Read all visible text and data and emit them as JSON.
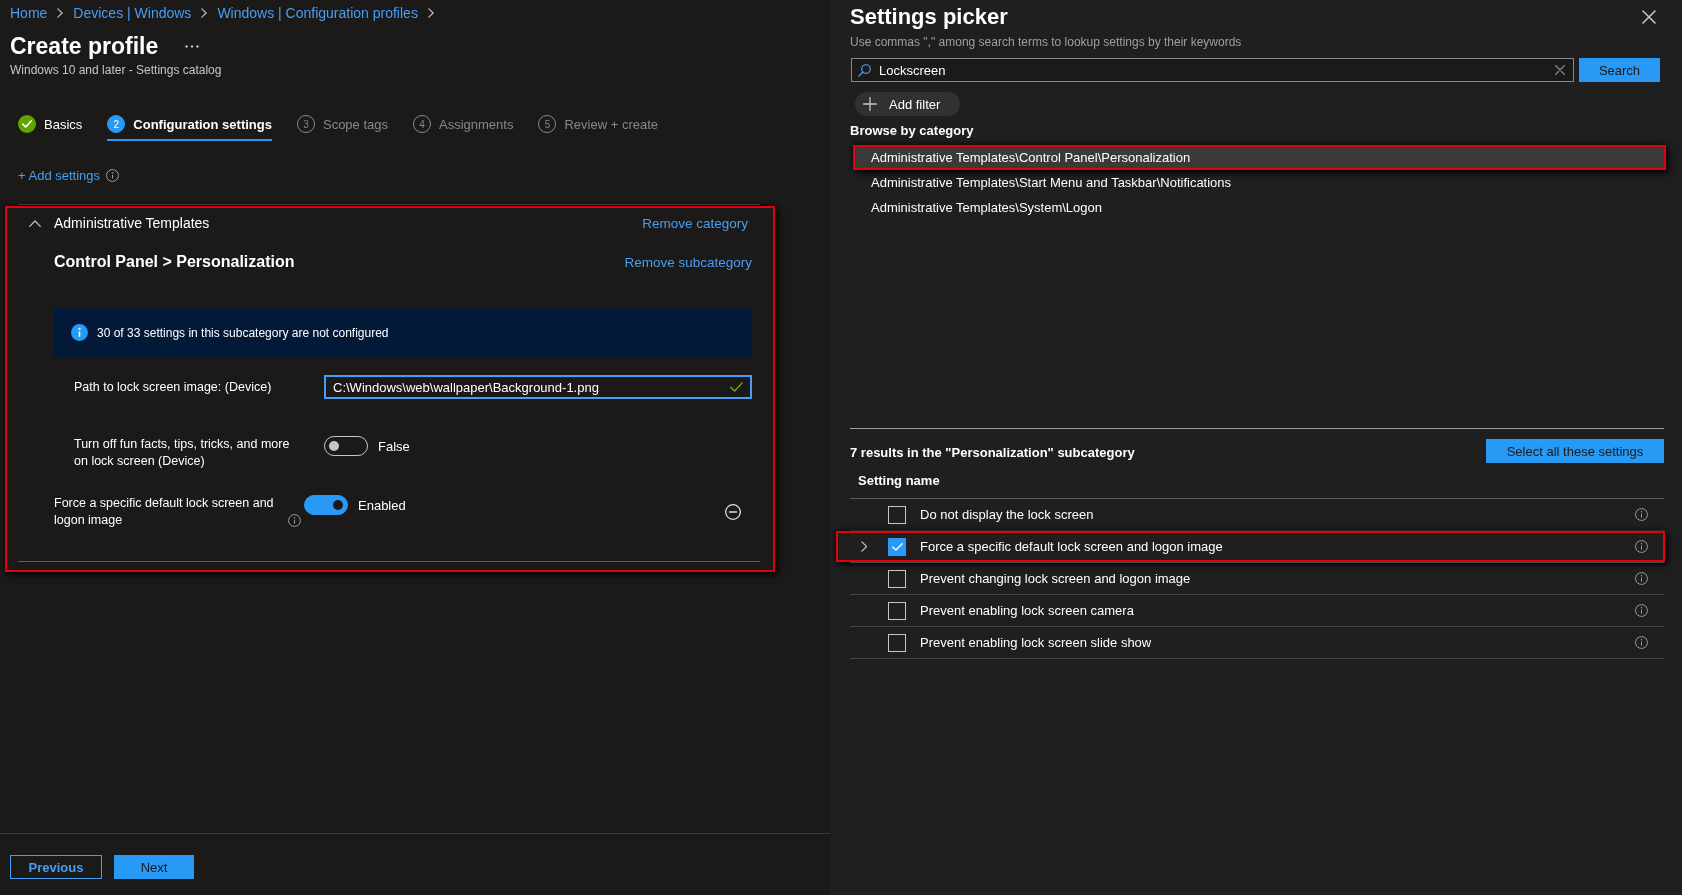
{
  "breadcrumb": [
    "Home",
    "Devices | Windows",
    "Windows | Configuration profiles"
  ],
  "header": {
    "title": "Create profile",
    "subtitle": "Windows 10 and later - Settings catalog"
  },
  "wizard_steps": [
    {
      "label": "Basics",
      "completed": true,
      "selected": false
    },
    {
      "number": "2",
      "label": "Configuration settings",
      "completed": false,
      "selected": true
    },
    {
      "number": "3",
      "label": "Scope tags",
      "completed": false,
      "selected": false
    },
    {
      "number": "4",
      "label": "Assignments",
      "completed": false,
      "selected": false
    },
    {
      "number": "5",
      "label": "Review + create",
      "completed": false,
      "selected": false
    }
  ],
  "add_settings": {
    "label": "+ Add settings"
  },
  "category": {
    "title": "Administrative Templates",
    "expanded": true,
    "highlighted": true,
    "remove_label": "Remove category",
    "subcategory": {
      "title": "Control Panel > Personalization",
      "remove_label": "Remove subcategory",
      "notice": "30 of 33 settings in this subcategory are not configured",
      "settings": [
        {
          "kind": "group",
          "children": [
            {
              "kind": "text",
              "label": "Path to lock screen image: (Device)",
              "value": "C:\\Windows\\web\\wallpaper\\Background-1.png",
              "focused": true,
              "valid": true
            },
            {
              "kind": "toggle",
              "label": "Turn off fun facts, tips, tricks, and more on lock screen (Device)",
              "on": false,
              "state_label": "False"
            }
          ]
        },
        {
          "kind": "toggle",
          "label": "Force a specific default lock screen and logon image",
          "on": true,
          "state_label": "Enabled",
          "info": true,
          "removable": true
        }
      ]
    }
  },
  "footer": {
    "buttons": [
      {
        "label": "Previous",
        "kind": "secondary"
      },
      {
        "label": "Next",
        "kind": "primary"
      }
    ]
  },
  "settings_picker": {
    "title": "Settings picker",
    "hint": "Use commas \",\" among search terms to lookup settings by their keywords",
    "search": {
      "value": "Lockscreen",
      "button": "Search"
    },
    "add_filter": "Add filter",
    "browse_heading": "Browse by category",
    "categories": [
      {
        "label": "Administrative Templates\\Control Panel\\Personalization",
        "selected": true,
        "highlighted": true
      },
      {
        "label": "Administrative Templates\\Start Menu and Taskbar\\Notifications",
        "selected": false,
        "highlighted": false
      },
      {
        "label": "Administrative Templates\\System\\Logon",
        "selected": false,
        "highlighted": false
      }
    ],
    "results": {
      "summary": "7 results in the \"Personalization\" subcategory",
      "select_all": "Select all these settings",
      "column": "Setting name",
      "rows": [
        {
          "label": "Do not display the lock screen",
          "checked": false,
          "expandable": false,
          "highlighted": false
        },
        {
          "label": "Force a specific default lock screen and logon image",
          "checked": true,
          "expandable": true,
          "highlighted": true
        },
        {
          "label": "Prevent changing lock screen and logon image",
          "checked": false,
          "expandable": false,
          "highlighted": false
        },
        {
          "label": "Prevent enabling lock screen camera",
          "checked": false,
          "expandable": false,
          "highlighted": false
        },
        {
          "label": "Prevent enabling lock screen slide show",
          "checked": false,
          "expandable": false,
          "highlighted": false
        }
      ]
    }
  }
}
